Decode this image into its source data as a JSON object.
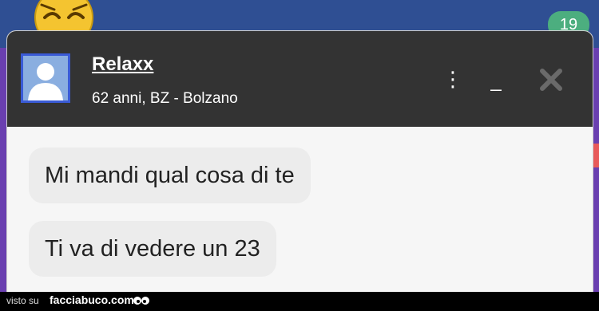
{
  "contact": {
    "name": "Relaxx",
    "info": "62 anni, BZ - Bolzano"
  },
  "header_controls": {
    "menu_icon": "more-vertical-icon",
    "minimize_label": "_",
    "close_icon": "close-icon",
    "menu_glyph": "⋮"
  },
  "notification_badge": "19",
  "messages": [
    {
      "text": "Mi mandi qual cosa di te"
    },
    {
      "text": "Ti va di vedere un 23"
    }
  ],
  "footer": {
    "visto_su": "visto su",
    "site": "facciabuco.com"
  },
  "colors": {
    "header_bg": "#333333",
    "bubble_bg": "#ececec",
    "badge": "#4cae7f",
    "avatar_border": "#3a5bd6"
  }
}
